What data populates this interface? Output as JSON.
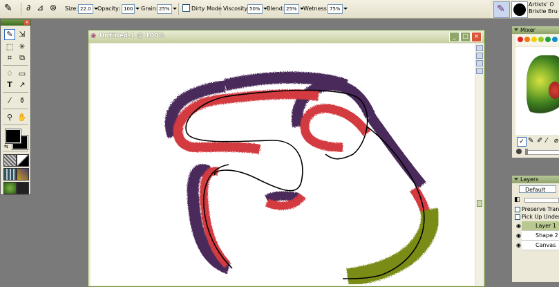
{
  "property_bar": {
    "size_label": "Size:",
    "size_value": "22.0",
    "opacity_label": "Opacity:",
    "opacity_value": "100",
    "grain_label": "Grain:",
    "grain_value": "25%",
    "dirty_mode_label": "Dirty Mode",
    "viscosity_label": "Viscosity:",
    "viscosity_value": "50%",
    "blend_label": "Blend:",
    "blend_value": "25%",
    "wetness_label": "Wetness:",
    "wetness_value": "75%"
  },
  "brush_selector": {
    "category": "Artists' O",
    "variant": "Bristle Bru"
  },
  "document": {
    "title": "Untitled-1 @ 100%"
  },
  "mixer": {
    "title": "Mixer",
    "swatch_colors": [
      "#e02020",
      "#f07a10",
      "#f5d000",
      "#9ccc20",
      "#20a040",
      "#1090d0"
    ]
  },
  "layers": {
    "title": "Layers",
    "composite_method": "Default",
    "preserve_transparency_label": "Preserve Trans",
    "pick_up_underlying_label": "Pick Up Underly",
    "items": [
      {
        "name": "Layer 1",
        "selected": true
      },
      {
        "name": "Shape 2",
        "selected": false
      },
      {
        "name": "Canvas",
        "selected": false
      }
    ]
  },
  "colors": {
    "stroke_purple": "#4a2a5a",
    "stroke_red": "#d33a40",
    "stroke_olive": "#7a8c18",
    "path_line": "#000000",
    "title_bar_green": "#6b8f3c"
  }
}
